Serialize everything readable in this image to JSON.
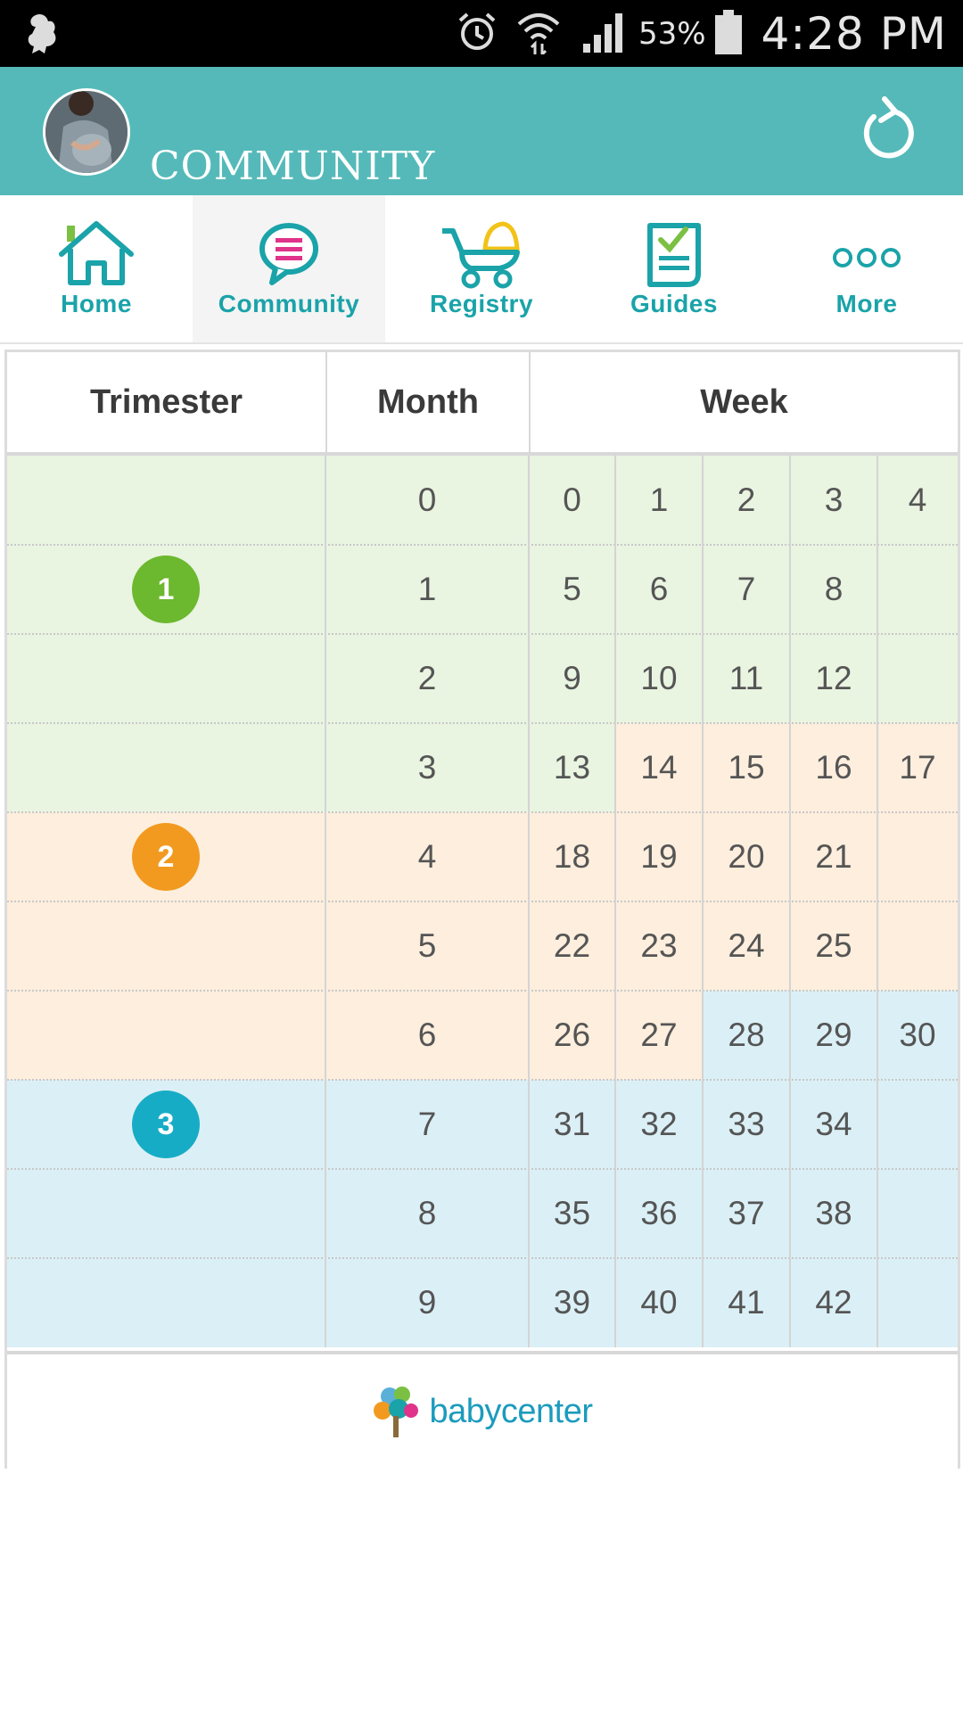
{
  "status_bar": {
    "battery_percent": "53%",
    "time": "4:28 PM",
    "icons": [
      "app-notification-icon",
      "alarm-icon",
      "wifi-icon",
      "signal-icon",
      "battery-icon"
    ]
  },
  "header": {
    "title": "COMMUNITY",
    "avatar_icon": "pregnant-profile-avatar",
    "refresh_icon": "refresh-icon"
  },
  "nav": {
    "items": [
      {
        "label": "Home",
        "icon": "home-icon",
        "active": false
      },
      {
        "label": "Community",
        "icon": "chat-bubble-icon",
        "active": true
      },
      {
        "label": "Registry",
        "icon": "stroller-icon",
        "active": false
      },
      {
        "label": "Guides",
        "icon": "checklist-icon",
        "active": false
      },
      {
        "label": "More",
        "icon": "more-dots-icon",
        "active": false
      }
    ],
    "accent_color": "#1aa3a9"
  },
  "table": {
    "headers": {
      "trimester": "Trimester",
      "month": "Month",
      "week": "Week"
    },
    "trimesters": [
      {
        "number": "1",
        "color": "#6cb82e"
      },
      {
        "number": "2",
        "color": "#f29a1f"
      },
      {
        "number": "3",
        "color": "#17acc6"
      }
    ],
    "months": [
      "0",
      "1",
      "2",
      "3",
      "4",
      "5",
      "6",
      "7",
      "8",
      "9"
    ],
    "weeks": [
      [
        "0",
        "1",
        "2",
        "3",
        "4"
      ],
      [
        "5",
        "6",
        "7",
        "8",
        ""
      ],
      [
        "9",
        "10",
        "11",
        "12",
        ""
      ],
      [
        "13",
        "14",
        "15",
        "16",
        "17"
      ],
      [
        "18",
        "19",
        "20",
        "21",
        ""
      ],
      [
        "22",
        "23",
        "24",
        "25",
        ""
      ],
      [
        "26",
        "27",
        "28",
        "29",
        "30"
      ],
      [
        "31",
        "32",
        "33",
        "34",
        ""
      ],
      [
        "35",
        "36",
        "37",
        "38",
        ""
      ],
      [
        "39",
        "40",
        "41",
        "42",
        ""
      ]
    ],
    "colors": {
      "green": "#e9f4e1",
      "orange": "#fdeedd",
      "blue": "#dbf0f6"
    }
  },
  "footer": {
    "logo_text": "babycenter"
  }
}
